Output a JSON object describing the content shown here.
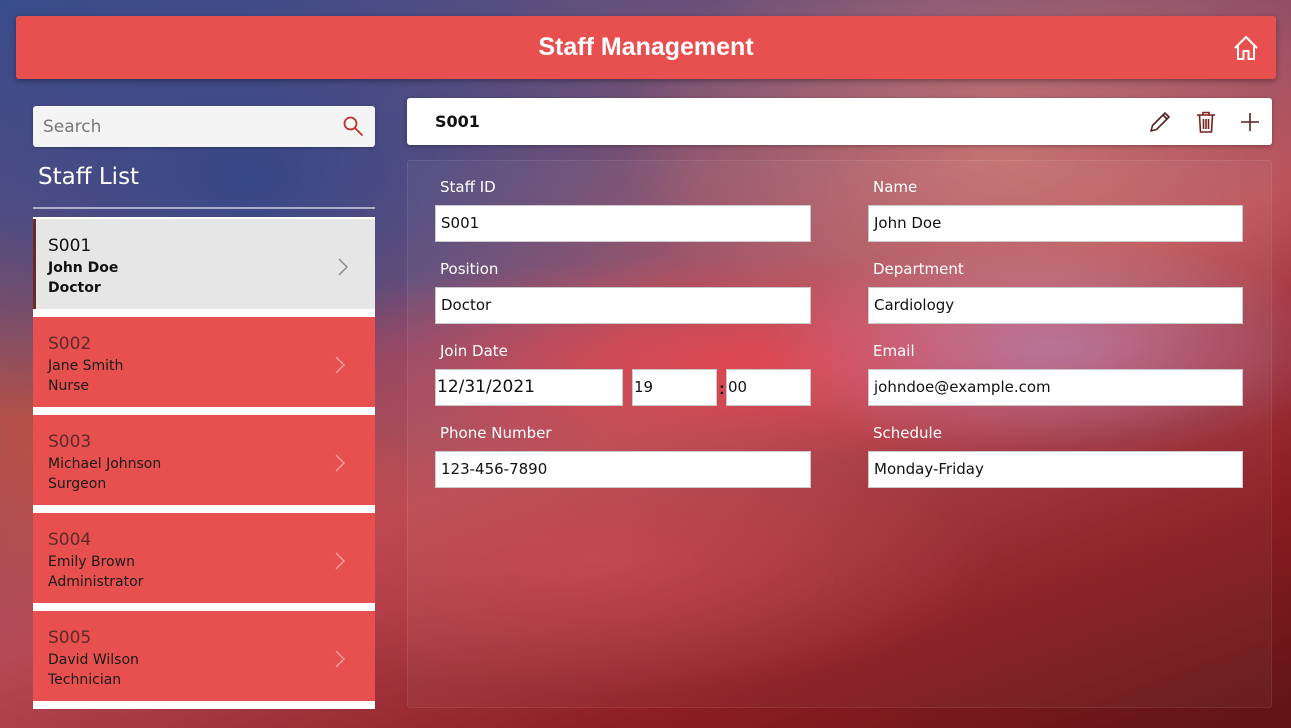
{
  "header": {
    "title": "Staff Management",
    "home_icon": "home-icon"
  },
  "search": {
    "placeholder": "Search",
    "icon": "search-icon"
  },
  "staff_list": {
    "title": "Staff List",
    "items": [
      {
        "id": "S001",
        "name": "John Doe",
        "position": "Doctor",
        "selected": true
      },
      {
        "id": "S002",
        "name": "Jane Smith",
        "position": "Nurse",
        "selected": false
      },
      {
        "id": "S003",
        "name": "Michael Johnson",
        "position": "Surgeon",
        "selected": false
      },
      {
        "id": "S004",
        "name": "Emily Brown",
        "position": "Administrator",
        "selected": false
      },
      {
        "id": "S005",
        "name": "David Wilson",
        "position": "Technician",
        "selected": false
      }
    ]
  },
  "detail": {
    "header_id": "S001",
    "tools": [
      "edit-icon",
      "delete-icon",
      "add-icon"
    ],
    "fields": {
      "staff_id": {
        "label": "Staff ID",
        "value": "S001"
      },
      "name": {
        "label": "Name",
        "value": "John Doe"
      },
      "position": {
        "label": "Position",
        "value": "Doctor"
      },
      "department": {
        "label": "Department",
        "value": "Cardiology"
      },
      "join_date": {
        "label": "Join Date",
        "date": "12/31/2021",
        "hour": "19",
        "separator": ":",
        "minute": "00"
      },
      "email": {
        "label": "Email",
        "value": "johndoe@example.com"
      },
      "phone": {
        "label": "Phone Number",
        "value": "123-456-7890"
      },
      "schedule": {
        "label": "Schedule",
        "value": "Monday-Friday"
      }
    }
  },
  "colors": {
    "accent": "#e8504f",
    "selected_bg": "#e6e6e6",
    "icon_dark": "#5a1f1f"
  }
}
